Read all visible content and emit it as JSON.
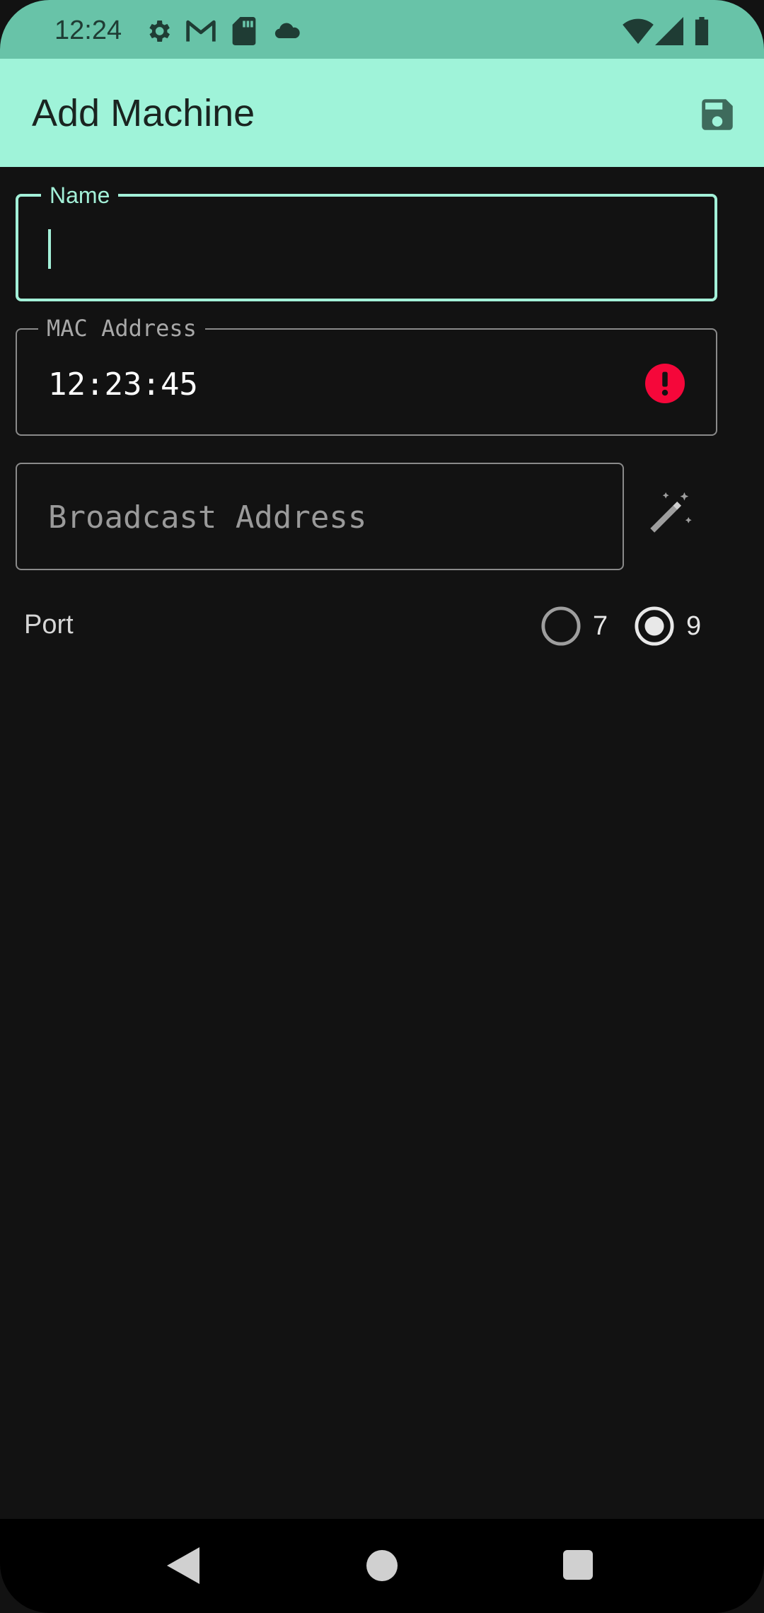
{
  "status_bar": {
    "time": "12:24",
    "left_icons": [
      "gear-icon",
      "gmail-icon",
      "sd-card-icon",
      "cloud-icon"
    ],
    "right_icons": [
      "wifi-icon",
      "signal-icon",
      "battery-icon"
    ]
  },
  "app_bar": {
    "title": "Add Machine",
    "action_icon": "save-icon"
  },
  "form": {
    "name": {
      "label": "Name",
      "value": ""
    },
    "mac": {
      "label": "MAC Address",
      "value": "12:23:45",
      "error_icon": "error-icon"
    },
    "broadcast": {
      "placeholder": "Broadcast Address",
      "value": "",
      "action_icon": "magic-wand-icon"
    },
    "port": {
      "label": "Port",
      "options": [
        "7",
        "9"
      ],
      "selected": "9"
    }
  },
  "nav_bar": {
    "buttons": [
      "back-icon",
      "home-icon",
      "recents-icon"
    ]
  },
  "colors": {
    "status_bar": "#68c3a8",
    "app_bar": "#9ff3d9",
    "accent": "#a3f0d8",
    "background": "#121212",
    "error": "#f5073a"
  }
}
